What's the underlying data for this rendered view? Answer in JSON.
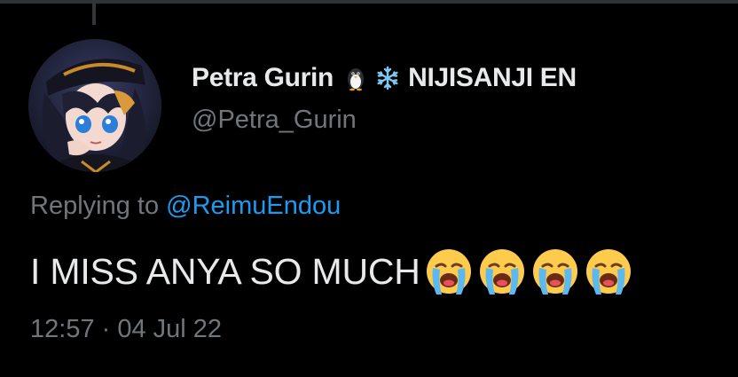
{
  "thread": {
    "has_parent_line": true
  },
  "author": {
    "display_name": "Petra Gurin",
    "affiliation": "NIJISANJI EN",
    "handle": "@Petra_Gurin",
    "badges": [
      "penguin-icon",
      "snowflake-icon"
    ],
    "avatar_icon": "anime-avatar-icon"
  },
  "reply": {
    "prefix": "Replying to",
    "mention": "@ReimuEndou"
  },
  "tweet": {
    "text": "I MISS ANYA SO MUCH",
    "emojis": [
      "loudly-crying-face-icon",
      "loudly-crying-face-icon",
      "loudly-crying-face-icon",
      "loudly-crying-face-icon"
    ]
  },
  "meta": {
    "timestamp": "12:57 · 04 Jul 22"
  },
  "colors": {
    "background": "#000000",
    "primary_text": "#e7e9ea",
    "secondary_text": "#71767b",
    "link": "#1d9bf0"
  }
}
